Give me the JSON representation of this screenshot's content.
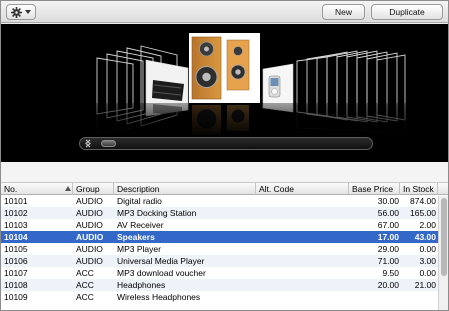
{
  "toolbar": {
    "actions_icon": "gear-icon",
    "new_label": "New",
    "duplicate_label": "Duplicate"
  },
  "coverflow": {
    "items": [
      "tv-stand",
      "speakers",
      "mp3-docking-station",
      "ipod"
    ]
  },
  "table": {
    "headers": {
      "no": "No.",
      "group": "Group",
      "description": "Description",
      "alt_code": "Alt. Code",
      "base_price": "Base Price",
      "in_stock": "In Stock"
    },
    "sort_column": "no",
    "rows": [
      {
        "no": "10101",
        "group": "AUDIO",
        "description": "Digital radio",
        "alt_code": "",
        "base_price": "30.00",
        "in_stock": "874.00"
      },
      {
        "no": "10102",
        "group": "AUDIO",
        "description": "MP3 Docking Station",
        "alt_code": "",
        "base_price": "56.00",
        "in_stock": "165.00"
      },
      {
        "no": "10103",
        "group": "AUDIO",
        "description": "AV Receiver",
        "alt_code": "",
        "base_price": "67.00",
        "in_stock": "2.00"
      },
      {
        "no": "10104",
        "group": "AUDIO",
        "description": "Speakers",
        "alt_code": "",
        "base_price": "17.00",
        "in_stock": "43.00"
      },
      {
        "no": "10105",
        "group": "AUDIO",
        "description": "MP3 Player",
        "alt_code": "",
        "base_price": "29.00",
        "in_stock": "0.00"
      },
      {
        "no": "10106",
        "group": "AUDIO",
        "description": "Universal Media Player",
        "alt_code": "",
        "base_price": "71.00",
        "in_stock": "3.00"
      },
      {
        "no": "10107",
        "group": "ACC",
        "description": "MP3 download voucher",
        "alt_code": "",
        "base_price": "9.50",
        "in_stock": "0.00"
      },
      {
        "no": "10108",
        "group": "ACC",
        "description": "Headphones",
        "alt_code": "",
        "base_price": "20.00",
        "in_stock": "21.00"
      },
      {
        "no": "10109",
        "group": "ACC",
        "description": "Wireless Headphones",
        "alt_code": "",
        "base_price": "",
        "in_stock": ""
      }
    ],
    "selected_index": 3
  },
  "colors": {
    "selection": "#3468c8",
    "alt_row": "#eef2f9",
    "coverflow_bg": "#000000"
  }
}
